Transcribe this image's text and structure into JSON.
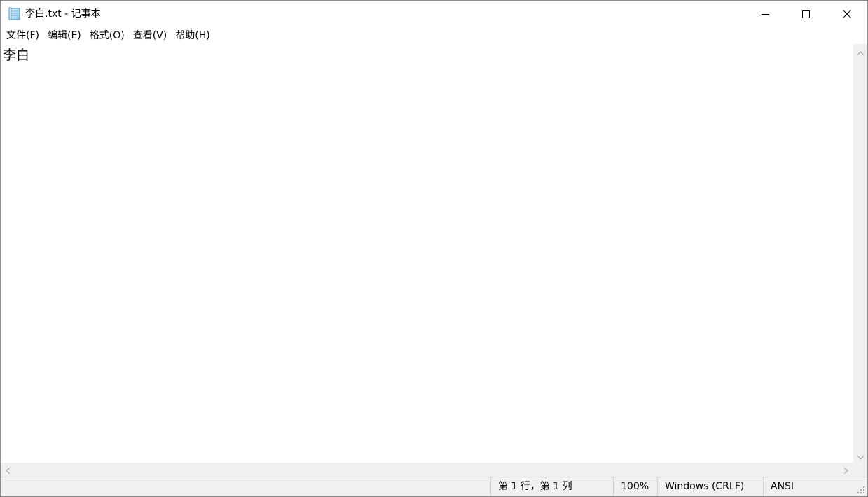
{
  "window": {
    "title": "李白.txt - 记事本",
    "app_icon": "notepad-icon",
    "controls": {
      "minimize_icon": "minimize-icon",
      "maximize_icon": "maximize-icon",
      "close_icon": "close-icon"
    }
  },
  "menu": {
    "items": [
      {
        "label": "文件(F)"
      },
      {
        "label": "编辑(E)"
      },
      {
        "label": "格式(O)"
      },
      {
        "label": "查看(V)"
      },
      {
        "label": "帮助(H)"
      }
    ]
  },
  "editor": {
    "content": "李白"
  },
  "scrollbars": {
    "up_icon": "chevron-up-icon",
    "down_icon": "chevron-down-icon",
    "left_icon": "chevron-left-icon",
    "right_icon": "chevron-right-icon"
  },
  "statusbar": {
    "position": "第 1 行，第 1 列",
    "zoom": "100%",
    "line_ending": "Windows (CRLF)",
    "encoding": "ANSI",
    "grip_icon": "resize-grip-icon"
  },
  "colors": {
    "chrome": "#f0f0f0",
    "border": "#8c8c8c",
    "text": "#000000",
    "icon_gray": "#a6a6a6"
  }
}
